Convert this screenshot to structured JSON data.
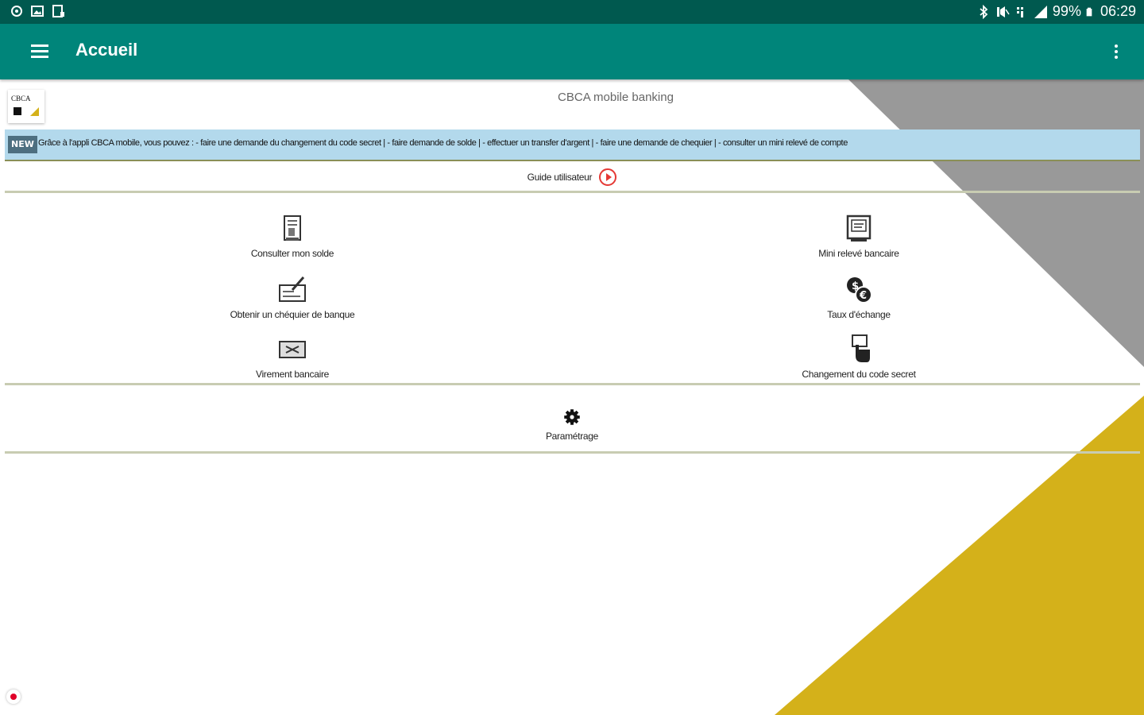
{
  "status_bar": {
    "battery": "99%",
    "time": "06:29",
    "left_icons": [
      "sync-icon",
      "image-icon",
      "document-icon"
    ],
    "right_icons": [
      "bluetooth-icon",
      "mute-icon",
      "wifi-icon",
      "signal-icon",
      "battery-icon"
    ]
  },
  "app_bar": {
    "title": "Accueil",
    "color": "#00857a",
    "status_color": "#00594f"
  },
  "header": {
    "logo_text": "CBCA",
    "subtitle": "CBCA mobile banking"
  },
  "ticker": {
    "badge": "NEW",
    "text": "Grâce à l'appli CBCA mobile, vous pouvez : - faire une demande du changement du code secret | - faire demande de solde | - effectuer un transfer d'argent | - faire une demande de chequier | - consulter un mini relevé de compte"
  },
  "guide": {
    "label": "Guide utilisateur"
  },
  "services": {
    "consulter_solde": "Consulter mon solde",
    "mini_releve": "Mini relevé bancaire",
    "chequier": "Obtenir un chéquier de banque",
    "taux": "Taux d'échange",
    "virement": "Virement bancaire",
    "code_secret": "Changement du code secret"
  },
  "settings": {
    "label": "Paramétrage"
  },
  "colors": {
    "accent_gold": "#d4b11a",
    "gray_triangle": "#999999",
    "ticker_bg": "#b3d9ec"
  }
}
